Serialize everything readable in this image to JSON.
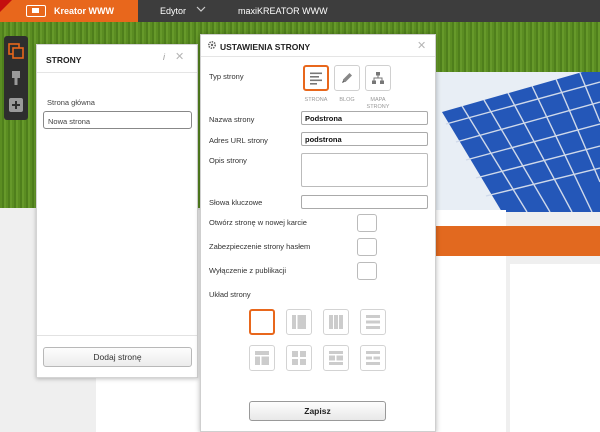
{
  "topbar": {
    "brand": "Kreator WWW",
    "menu_editor": "Edytor",
    "menu_product": "maxiKREATOR WWW"
  },
  "strony_panel": {
    "title": "STRONY",
    "info_icon": "info-icon",
    "close_icon": "close-icon",
    "pages": [
      {
        "label": "Strona główna",
        "selected": false
      },
      {
        "label": "Nowa strona",
        "selected": true
      }
    ],
    "add_button": "Dodaj stronę"
  },
  "settings": {
    "title": "USTAWIENIA STRONY",
    "page_type_label": "Typ strony",
    "page_types": [
      {
        "caption": "STRONA",
        "icon": "page-lines-icon",
        "selected": true
      },
      {
        "caption": "BLOG",
        "icon": "pencil-icon",
        "selected": false
      },
      {
        "caption": "MAPA STRONY",
        "icon": "sitemap-icon",
        "selected": false
      }
    ],
    "name_label": "Nazwa strony",
    "name_value": "Podstrona",
    "url_label": "Adres URL strony",
    "url_value": "podstrona",
    "description_label": "Opis strony",
    "description_value": "",
    "keywords_label": "Słowa kluczowe",
    "keywords_value": "",
    "new_tab_label": "Otwórz stronę w nowej karcie",
    "password_label": "Zabezpieczenie strony hasłem",
    "unpublish_label": "Wyłączenie z publikacji",
    "layout_label": "Układ strony",
    "save_button": "Zapisz"
  },
  "colors": {
    "accent": "#e8671c",
    "topbar": "#3d3d3d"
  }
}
